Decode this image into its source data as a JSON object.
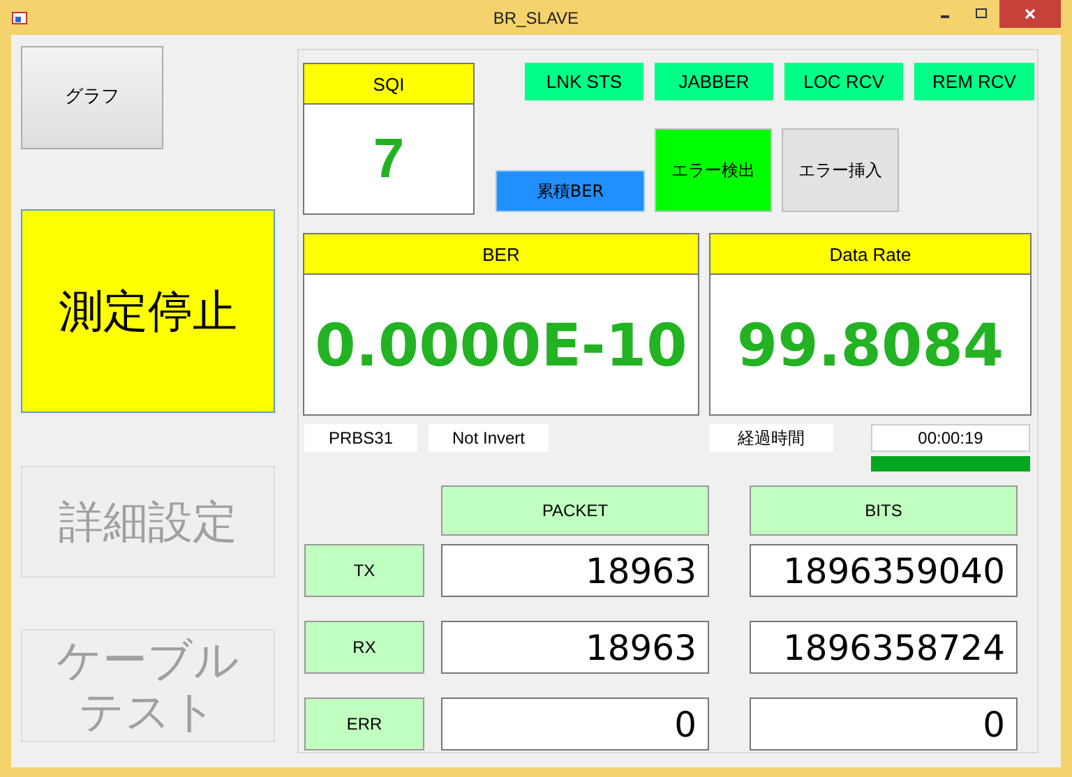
{
  "window": {
    "title": "BR_SLAVE"
  },
  "side_buttons": [
    {
      "label": "グラフ",
      "kind": "small",
      "disabled": false
    },
    {
      "label": "測定停止",
      "kind": "primary",
      "disabled": false
    },
    {
      "label": "詳細設定",
      "kind": "large",
      "disabled": true
    },
    {
      "label": "ケーブルテスト",
      "kind": "large",
      "disabled": true
    }
  ],
  "sqi": {
    "label": "SQI",
    "value": "7"
  },
  "indicators": [
    {
      "label": "LNK STS",
      "on": true
    },
    {
      "label": "JABBER",
      "on": true
    },
    {
      "label": "LOC RCV",
      "on": true
    },
    {
      "label": "REM RCV",
      "on": true
    }
  ],
  "mode_buttons": [
    {
      "label": "累積BER",
      "kind": "wide",
      "on": true
    },
    {
      "label": "エラー検出",
      "kind": "square",
      "on": true
    },
    {
      "label": "エラー挿入",
      "kind": "square",
      "on": false
    }
  ],
  "panels": [
    {
      "label": "BER",
      "value": "0.0000E-10"
    },
    {
      "label": "Data Rate",
      "value": "99.8084"
    }
  ],
  "pattern": "PRBS31",
  "invert": "Not Invert",
  "elapsed_label": "経過時間",
  "elapsed": "00:00:19",
  "progress": {
    "level": 1.0
  },
  "table": {
    "columns": [
      "PACKET",
      "BITS"
    ],
    "rows": [
      {
        "label": "TX",
        "values": [
          "18963",
          "1896359040"
        ]
      },
      {
        "label": "RX",
        "values": [
          "18963",
          "1896358724"
        ]
      },
      {
        "label": "ERR",
        "values": [
          "0",
          "0"
        ]
      }
    ]
  }
}
